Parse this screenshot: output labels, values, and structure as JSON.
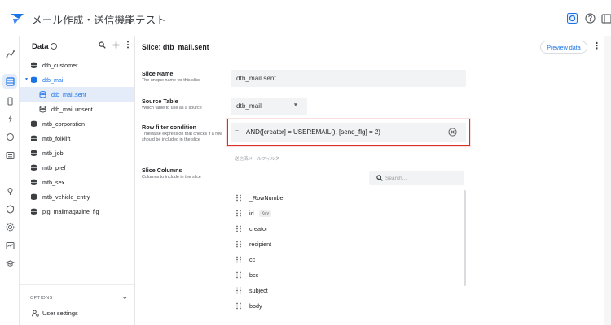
{
  "header": {
    "app_title": "メール作成・送信機能テスト",
    "icons": [
      "appsheet-logo-icon",
      "preview-icon",
      "help-icon",
      "window-icon"
    ],
    "accent": "#1a73e8"
  },
  "rail": {
    "icons": [
      "data-icon",
      "table-icon",
      "device-icon",
      "automation-icon",
      "action-icon",
      "views-icon",
      "security-icon",
      "integrations-icon",
      "settings-icon",
      "monitor-icon",
      "learn-icon"
    ]
  },
  "data_panel": {
    "title": "Data",
    "search_icon": "search-icon",
    "add_icon": "add-icon",
    "items": [
      {
        "label": "dtb_customer",
        "type": "table"
      },
      {
        "label": "dtb_mail",
        "type": "table",
        "expanded": true
      },
      {
        "label": "dtb_mail.sent",
        "type": "slice",
        "selected": true
      },
      {
        "label": "dtb_mail.unsent",
        "type": "slice"
      },
      {
        "label": "mtb_corporation",
        "type": "table"
      },
      {
        "label": "mtb_folklift",
        "type": "table"
      },
      {
        "label": "mtb_job",
        "type": "table"
      },
      {
        "label": "mtb_pref",
        "type": "table"
      },
      {
        "label": "mtb_sex",
        "type": "table"
      },
      {
        "label": "mtb_vehicle_entry",
        "type": "table"
      },
      {
        "label": "plg_mailmagazine_flg",
        "type": "table"
      }
    ],
    "options_label": "OPTIONS",
    "user_settings": "User settings"
  },
  "main": {
    "title": "Slice: dtb_mail.sent",
    "preview_button": "Preview data",
    "slice_name": {
      "label": "Slice Name",
      "description": "The unique name for this slice",
      "value": "dtb_mail.sent"
    },
    "source_table": {
      "label": "Source Table",
      "description": "Which table to use as a source",
      "value": "dtb_mail"
    },
    "row_filter": {
      "label": "Row filter condition",
      "description": "True/false expression that checks if a row should be included in the slice",
      "value": "AND([creator] = USEREMAIL(), [send_flg] = 2)",
      "hint": "送信済メールフィルター",
      "highlight_color": "#d93025"
    },
    "slice_columns": {
      "label": "Slice Columns",
      "description": "Columns to include in the slice",
      "search_placeholder": "Search...",
      "columns": [
        {
          "name": "_RowNumber",
          "badge": ""
        },
        {
          "name": "id",
          "badge": "Key"
        },
        {
          "name": "creator",
          "badge": ""
        },
        {
          "name": "recipient",
          "badge": ""
        },
        {
          "name": "cc",
          "badge": ""
        },
        {
          "name": "bcc",
          "badge": ""
        },
        {
          "name": "subject",
          "badge": ""
        },
        {
          "name": "body",
          "badge": ""
        }
      ]
    }
  }
}
